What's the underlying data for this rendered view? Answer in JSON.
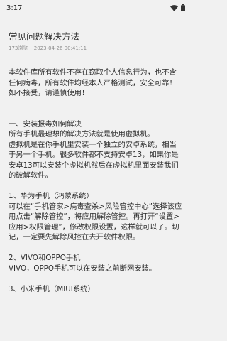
{
  "status_bar": {
    "time": "3:17",
    "icons": [
      "wifi-icon",
      "battery-icon"
    ]
  },
  "article": {
    "title": "常见问题解决方法",
    "views": "173浏览",
    "date": "2023-04-26 00:41:11",
    "intro": "本软件库所有软件不存在窃取个人信息行为，也不含任何病毒，所有软件均经本人严格测试，安全可靠！如不接受，请谨慎使用！",
    "section1_heading": "一、安装报毒如何解决",
    "section1_line": "所有手机最理想的解决方法就是使用虚拟机。",
    "section1_body": "虚拟机是在你手机里安装一个独立的安卓系统，相当于另一个手机。很多软件都不支持安卓13，如果你是安卓13可以安装个虚拟机然后在虚拟机里面安装我们的破解软件。",
    "huawei_heading": "1、华为手机（鸿蒙系统）",
    "huawei_body": "可以在“手机管家>病毒查杀>风险管控中心”选择该应用点击“解除管控”，将应用解除管控。再打开“设置>应用>权限管理”，修改权限设置，这样就可以了。切记，一定要先解除风控在去开软件权限。",
    "vivo_heading": "2、VIVO和OPPO手机",
    "vivo_body": "VIVO，OPPO手机可以在安装之前断网安装。",
    "xiaomi_heading": "3、小米手机（MIUI系统）"
  }
}
